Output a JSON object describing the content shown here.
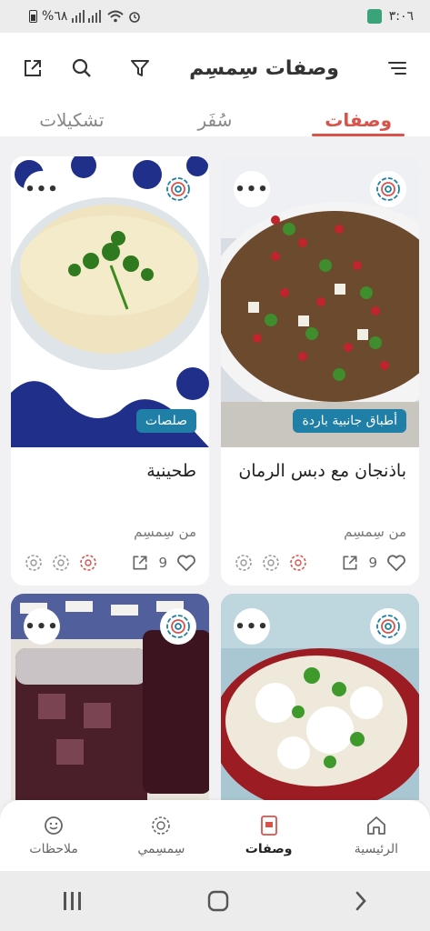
{
  "status_bar": {
    "time": "٣:٠٦",
    "battery": "%٦٨"
  },
  "header": {
    "title": "وصفات سِمسِم"
  },
  "tabs": [
    {
      "label": "وصفات",
      "active": true
    },
    {
      "label": "سُفَر",
      "active": false
    },
    {
      "label": "تشكيلات",
      "active": false
    }
  ],
  "recipes": [
    {
      "title": "باذنجان مع دبس الرمان",
      "category": "أطباق جانبية باردة",
      "source": "من سِمسِم",
      "likes": "9"
    },
    {
      "title": "طحينية",
      "category": "صلصات",
      "source": "من سِمسِم",
      "likes": "9"
    },
    {
      "title": "",
      "category": "",
      "source": "",
      "likes": ""
    },
    {
      "title": "",
      "category": "",
      "source": "",
      "likes": ""
    }
  ],
  "bottom_nav": [
    {
      "label": "الرئيسية",
      "icon": "home-icon",
      "active": false
    },
    {
      "label": "وصفات",
      "icon": "recipe-book-icon",
      "active": true
    },
    {
      "label": "سِمسِمي",
      "icon": "rosette-icon",
      "active": false
    },
    {
      "label": "ملاحظات",
      "icon": "smiley-icon",
      "active": false
    }
  ],
  "colors": {
    "accent": "#d9534a",
    "category_badge": "#1f7fa6"
  }
}
